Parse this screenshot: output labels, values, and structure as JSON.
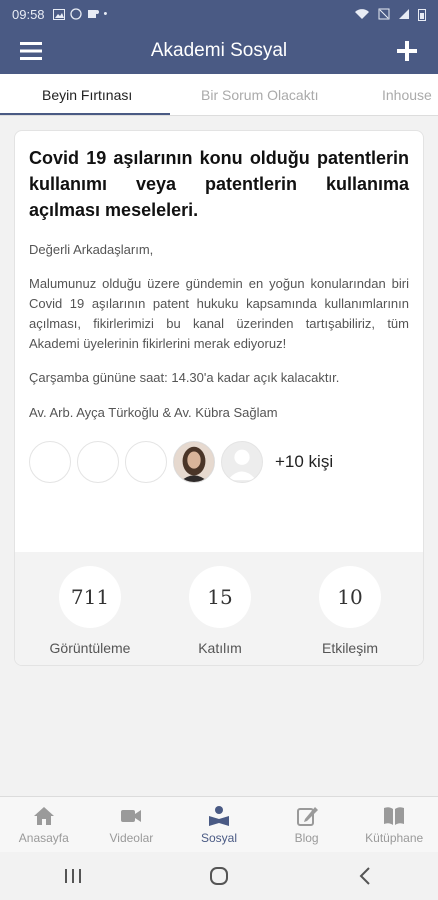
{
  "status_bar": {
    "time": "09:58"
  },
  "app": {
    "title": "Akademi Sosyal"
  },
  "tabs": [
    {
      "label": "Beyin Fırtınası"
    },
    {
      "label": "Bir Sorum Olacaktı"
    },
    {
      "label": "Inhouse"
    }
  ],
  "post": {
    "title": "Covid 19 aşılarının konu olduğu patentlerin kullanımı veya patentlerin kullanıma açılması meseleleri.",
    "greeting": "Değerli Arkadaşlarım,",
    "body": "Malumunuz olduğu üzere gündemin en yoğun konularından biri Covid 19 aşılarının patent hukuku kapsamında kullanımlarının açılması, fikirlerimizi bu kanal üzerinden tartışabiliriz, tüm Akademi üyelerinin fikirlerini merak ediyoruz!",
    "deadline": "Çarşamba gününe saat: 14.30'a kadar açık kalacaktır.",
    "signature": "Av. Arb. Ayça Türkoğlu & Av. Kübra Sağlam",
    "more_participants": "+10 kişi"
  },
  "stats": [
    {
      "value": "711",
      "label": "Görüntüleme"
    },
    {
      "value": "15",
      "label": "Katılım"
    },
    {
      "value": "10",
      "label": "Etkileşim"
    }
  ],
  "bottom_nav": [
    {
      "label": "Anasayfa",
      "icon": "home-icon"
    },
    {
      "label": "Videolar",
      "icon": "video-camera-icon"
    },
    {
      "label": "Sosyal",
      "icon": "social-reader-icon"
    },
    {
      "label": "Blog",
      "icon": "edit-icon"
    },
    {
      "label": "Kütüphane",
      "icon": "book-icon"
    }
  ],
  "colors": {
    "primary": "#4a5a84",
    "background": "#f2f2f2",
    "inactive": "#9a9a9a"
  }
}
